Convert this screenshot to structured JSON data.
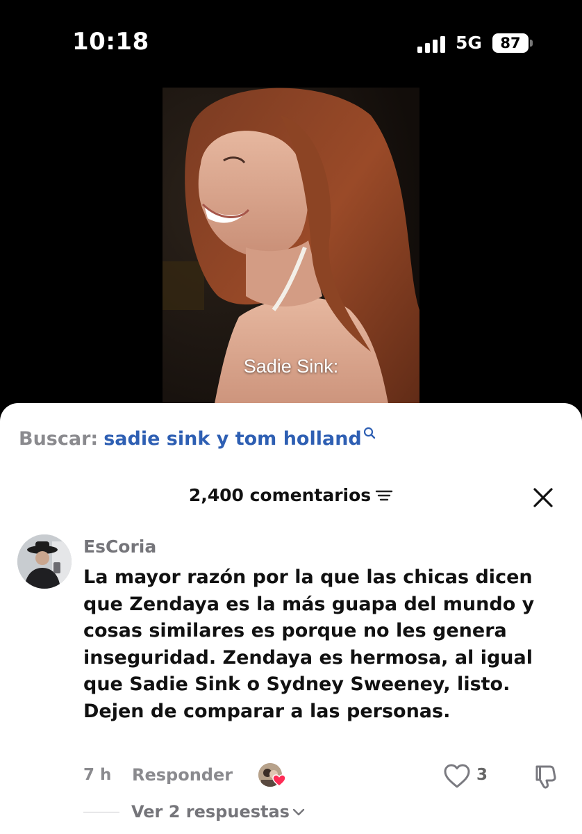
{
  "status_bar": {
    "time": "10:18",
    "network": "5G",
    "battery": "87"
  },
  "video": {
    "caption": "Sadie Sink:"
  },
  "search": {
    "prefix": "Buscar:",
    "query": "sadie sink y tom holland",
    "accent_color": "#2e5fb3"
  },
  "comments": {
    "count_label": "2,400 comentarios",
    "items": [
      {
        "username": "EsCoria",
        "text": "La mayor razón por la que las chicas dicen que Zendaya es la más guapa del mundo y cosas similares es porque no les genera inseguridad. Zendaya es hermosa, al igual que Sadie Sink o Sydney Sweeney, listo. Dejen de comparar a las personas.",
        "timestamp": "7 h",
        "reply_label": "Responder",
        "like_count": "3",
        "view_replies_label": "Ver 2 respuestas"
      }
    ]
  },
  "icons": {
    "search": "search-icon",
    "sort": "sort-icon",
    "close": "close-icon",
    "like": "heart-outline-icon",
    "dislike": "thumbs-down-icon",
    "chevron": "chevron-down-icon"
  }
}
